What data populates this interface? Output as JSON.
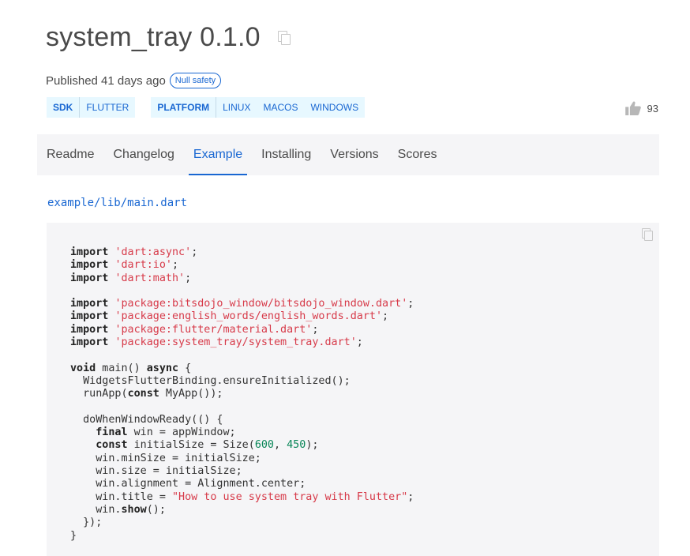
{
  "package": {
    "title": "system_tray 0.1.0",
    "published": "Published 41 days ago",
    "null_safety_badge": "Null safety",
    "likes": "93"
  },
  "tags": [
    {
      "head": "SDK",
      "items": [
        "FLUTTER"
      ]
    },
    {
      "head": "PLATFORM",
      "items": [
        "LINUX",
        "MACOS",
        "WINDOWS"
      ]
    }
  ],
  "tabs": [
    {
      "label": "Readme",
      "active": false
    },
    {
      "label": "Changelog",
      "active": false
    },
    {
      "label": "Example",
      "active": true
    },
    {
      "label": "Installing",
      "active": false
    },
    {
      "label": "Versions",
      "active": false
    },
    {
      "label": "Scores",
      "active": false
    }
  ],
  "example": {
    "file_path": "example/lib/main.dart",
    "code_lines": [
      [
        [
          "k",
          "import"
        ],
        [
          "p",
          " "
        ],
        [
          "s",
          "'dart:async'"
        ],
        [
          "p",
          ";"
        ]
      ],
      [
        [
          "k",
          "import"
        ],
        [
          "p",
          " "
        ],
        [
          "s",
          "'dart:io'"
        ],
        [
          "p",
          ";"
        ]
      ],
      [
        [
          "k",
          "import"
        ],
        [
          "p",
          " "
        ],
        [
          "s",
          "'dart:math'"
        ],
        [
          "p",
          ";"
        ]
      ],
      [],
      [
        [
          "k",
          "import"
        ],
        [
          "p",
          " "
        ],
        [
          "s",
          "'package:bitsdojo_window/bitsdojo_window.dart'"
        ],
        [
          "p",
          ";"
        ]
      ],
      [
        [
          "k",
          "import"
        ],
        [
          "p",
          " "
        ],
        [
          "s",
          "'package:english_words/english_words.dart'"
        ],
        [
          "p",
          ";"
        ]
      ],
      [
        [
          "k",
          "import"
        ],
        [
          "p",
          " "
        ],
        [
          "s",
          "'package:flutter/material.dart'"
        ],
        [
          "p",
          ";"
        ]
      ],
      [
        [
          "k",
          "import"
        ],
        [
          "p",
          " "
        ],
        [
          "s",
          "'package:system_tray/system_tray.dart'"
        ],
        [
          "p",
          ";"
        ]
      ],
      [],
      [
        [
          "k",
          "void"
        ],
        [
          "p",
          " main() "
        ],
        [
          "k",
          "async"
        ],
        [
          "p",
          " {"
        ]
      ],
      [
        [
          "p",
          "  WidgetsFlutterBinding.ensureInitialized();"
        ]
      ],
      [
        [
          "p",
          "  runApp("
        ],
        [
          "k",
          "const"
        ],
        [
          "p",
          " MyApp());"
        ]
      ],
      [],
      [
        [
          "p",
          "  doWhenWindowReady(() {"
        ]
      ],
      [
        [
          "p",
          "    "
        ],
        [
          "k",
          "final"
        ],
        [
          "p",
          " win = appWindow;"
        ]
      ],
      [
        [
          "p",
          "    "
        ],
        [
          "k",
          "const"
        ],
        [
          "p",
          " initialSize = Size("
        ],
        [
          "n",
          "600"
        ],
        [
          "p",
          ", "
        ],
        [
          "n",
          "450"
        ],
        [
          "p",
          ");"
        ]
      ],
      [
        [
          "p",
          "    win.minSize = initialSize;"
        ]
      ],
      [
        [
          "p",
          "    win.size = initialSize;"
        ]
      ],
      [
        [
          "p",
          "    win.alignment = Alignment.center;"
        ]
      ],
      [
        [
          "p",
          "    win.title = "
        ],
        [
          "s",
          "\"How to use system tray with Flutter\""
        ],
        [
          "p",
          ";"
        ]
      ],
      [
        [
          "p",
          "    win."
        ],
        [
          "k",
          "show"
        ],
        [
          "p",
          "();"
        ]
      ],
      [
        [
          "p",
          "  });"
        ]
      ],
      [
        [
          "p",
          "}"
        ]
      ]
    ]
  },
  "colors": {
    "accent": "#1967d2",
    "tag_bg": "#e7f8ff",
    "tabs_bg": "#f5f5f7",
    "string": "#d73a49",
    "number": "#098658"
  },
  "icons": {
    "title_copy": "copy-icon",
    "likes": "thumbs-up-icon",
    "code_copy": "copy-icon"
  }
}
